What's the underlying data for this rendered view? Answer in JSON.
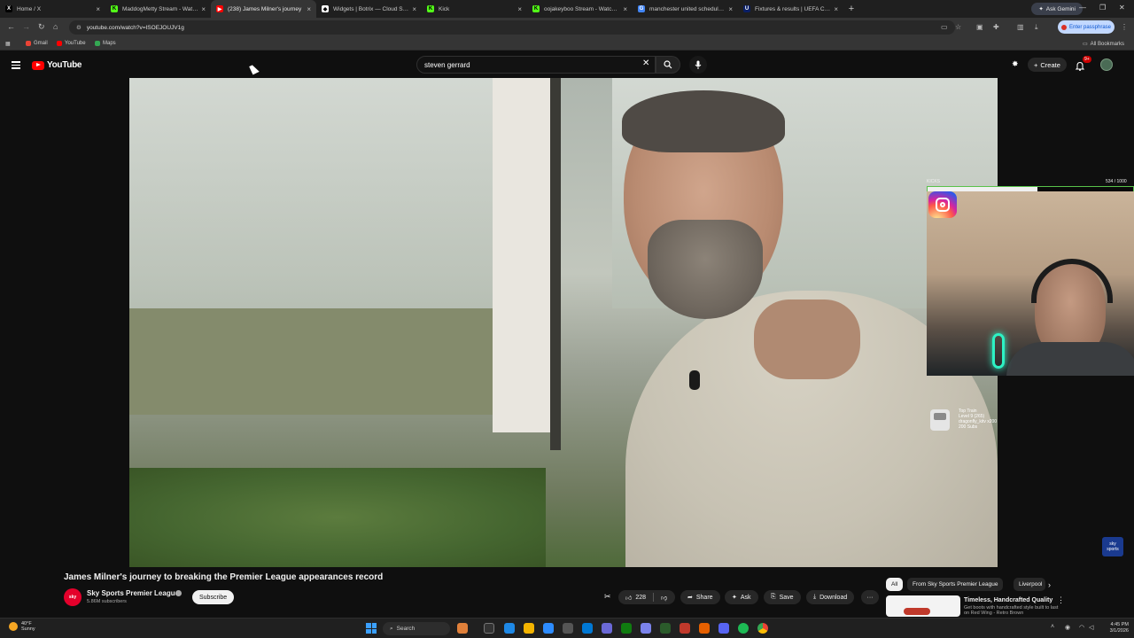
{
  "browser": {
    "tabs": [
      {
        "title": "Home / X",
        "color": "#000000",
        "glyph": "X"
      },
      {
        "title": "MaddogMetty Stream - Watch Live on Kick",
        "color": "#53fc18",
        "glyph": "K"
      },
      {
        "title": "(238) James Milner's journey",
        "color": "#ff0000",
        "glyph": "▶",
        "active": true
      },
      {
        "title": "Widgets | Botrix — Cloud Stream",
        "color": "#ffffff",
        "glyph": "◆"
      },
      {
        "title": "Kick",
        "color": "#53fc18",
        "glyph": "K"
      },
      {
        "title": "oojakeyboo Stream - Watch Live on Kick",
        "color": "#53fc18",
        "glyph": "K"
      },
      {
        "title": "manchester united schedule - Google Search",
        "color": "#4285f4",
        "glyph": "G"
      },
      {
        "title": "Fixtures & results | UEFA Champions League",
        "color": "#0a1f66",
        "glyph": "U"
      }
    ],
    "new_tab": "+",
    "ask_gemini": "Ask Gemini",
    "url": "youtube.com/watch?v=ISOEJOUJV1g",
    "passphrase": "Enter passphrase",
    "bookmarks": [
      {
        "label": "Gmail",
        "color": "#ea4335"
      },
      {
        "label": "YouTube",
        "color": "#ff0000"
      },
      {
        "label": "Maps",
        "color": "#34a853"
      }
    ],
    "all_bookmarks": "All Bookmarks"
  },
  "youtube": {
    "logo_text": "YouTube",
    "search_query": "steven gerrard",
    "create_label": "Create",
    "notification_count": "9+"
  },
  "overlay": {
    "kicks_label": "KICKS",
    "kicks_count": "534 / 1000",
    "kicks_progress": 0.534,
    "train_lines": [
      "Top Train",
      "Level 9 (265)",
      "dragonfly_kitv x200",
      "200 Subs"
    ],
    "sky_badge": [
      "sky",
      "sports"
    ]
  },
  "video_info": {
    "title": "James Milner's journey to breaking the Premier League appearances record",
    "channel_name": "Sky Sports Premier League",
    "channel_avatar_text": "sky",
    "subscribers": "5.86M subscribers",
    "subscribe_label": "Subscribe",
    "like_count": "228",
    "share_label": "Share",
    "ask_label": "Ask",
    "save_label": "Save",
    "download_label": "Download",
    "more_label": "···"
  },
  "recommendations": {
    "chips": [
      "All",
      "From Sky Sports Premier League",
      "Liverpool"
    ],
    "ad_title": "Timeless, Handcrafted Quality",
    "ad_desc": "Get boots with handcrafted style built to last on Red Wing - Retro Brown"
  },
  "taskbar": {
    "weather_temp": "40°F",
    "weather_cond": "Sunny",
    "search_label": "Search",
    "time": "4:45 PM",
    "date": "3/1/2026"
  }
}
